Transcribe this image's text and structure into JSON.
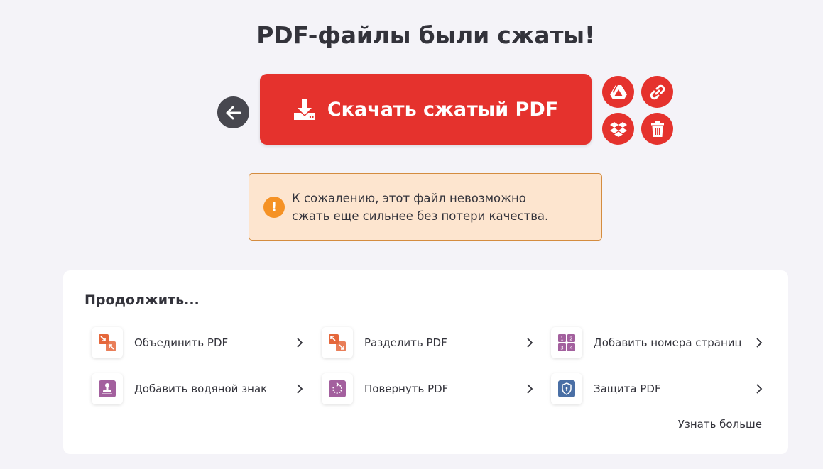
{
  "page": {
    "title": "PDF-файлы были сжаты!"
  },
  "actions": {
    "back_icon": "arrow-left-icon",
    "download_label": "Скачать сжатый PDF",
    "download_icon": "download-icon",
    "google_drive_icon": "google-drive-icon",
    "share_link_icon": "link-icon",
    "dropbox_icon": "dropbox-icon",
    "delete_icon": "trash-icon"
  },
  "warning": {
    "icon": "exclamation-icon",
    "line1": "К сожалению, этот файл невозможно",
    "line2": "сжать еще сильнее без потери качества."
  },
  "continue": {
    "title": "Продолжить...",
    "tools": [
      {
        "label": "Объединить PDF",
        "icon": "merge-icon"
      },
      {
        "label": "Разделить PDF",
        "icon": "split-icon"
      },
      {
        "label": "Добавить номера страниц",
        "icon": "page-numbers-icon"
      },
      {
        "label": "Добавить водяной знак",
        "icon": "watermark-stamp-icon"
      },
      {
        "label": "Повернуть PDF",
        "icon": "rotate-icon"
      },
      {
        "label": "Защита PDF",
        "icon": "shield-icon"
      }
    ],
    "learn_more": "Узнать больше"
  },
  "colors": {
    "brand_red": "#e5322d",
    "dark_button": "#47474f",
    "warning_bg": "#fde5cf",
    "warning_border": "#d48c3f",
    "warning_icon": "#f59225",
    "orange_tool": "#e5673b",
    "purple_tool": "#a3609e",
    "blue_tool": "#4a6fa5"
  }
}
